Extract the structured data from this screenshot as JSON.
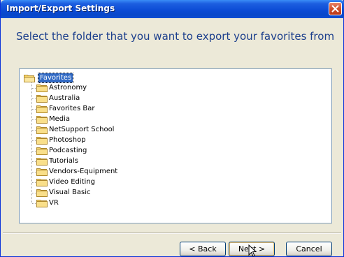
{
  "window": {
    "title": "Import/Export Settings"
  },
  "instruction": "Select the folder that you want to export your favorites from",
  "tree": {
    "root": "Favorites",
    "children": [
      "Astronomy",
      "Australia",
      "Favorites Bar",
      "Media",
      "NetSupport School",
      "Photoshop",
      "Podcasting",
      "Tutorials",
      "Vendors-Equipment",
      "Video Editing",
      "Visual Basic",
      "VR"
    ]
  },
  "buttons": {
    "back": "< Back",
    "next": "Next >",
    "cancel": "Cancel"
  },
  "colors": {
    "title_bar": "#0a4ad4",
    "instruction_text": "#1c3f8c",
    "selection": "#316ac5",
    "folder_yellow": "#f6d46b"
  },
  "icons": {
    "close": "close-icon",
    "folder": "folder-icon",
    "cursor": "mouse-pointer-icon"
  }
}
